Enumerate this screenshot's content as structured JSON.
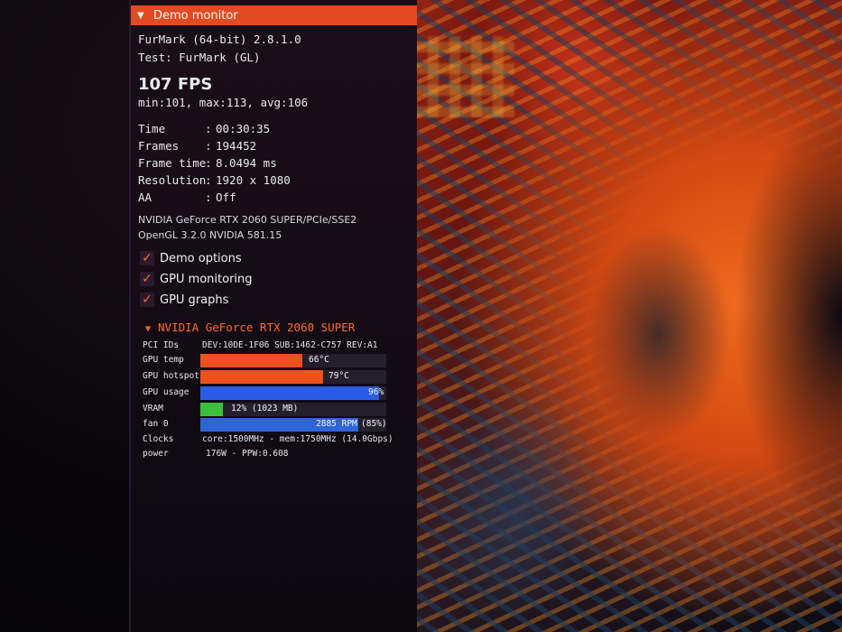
{
  "window": {
    "title": "Demo monitor"
  },
  "app": {
    "version_line": "FurMark (64-bit) 2.8.1.0",
    "test_line": "Test: FurMark (GL)"
  },
  "fps": {
    "value": "107 FPS",
    "stats": "min:101, max:113, avg:106"
  },
  "info": [
    {
      "key": "Time",
      "value": "00:30:35"
    },
    {
      "key": "Frames",
      "value": "194452"
    },
    {
      "key": "Frame time",
      "value": "8.0494 ms"
    },
    {
      "key": "Resolution",
      "value": "1920 x 1080"
    },
    {
      "key": "AA",
      "value": "Off"
    }
  ],
  "renderer": {
    "gpu_line": "NVIDIA GeForce RTX 2060 SUPER/PCIe/SSE2",
    "gl_line": "OpenGL 3.2.0 NVIDIA 581.15"
  },
  "options": [
    {
      "label": "Demo options",
      "checked": true
    },
    {
      "label": "GPU monitoring",
      "checked": true
    },
    {
      "label": "GPU graphs",
      "checked": true
    }
  ],
  "gpu": {
    "name": "NVIDIA GeForce RTX 2060 SUPER",
    "pci_label": "PCI IDs",
    "pci_value": "DEV:10DE-1F06 SUB:1462-C757 REV:A1",
    "temp": {
      "label": "GPU temp",
      "text": "66°C",
      "fraction": 0.55,
      "color": "#f0501c"
    },
    "hotspot": {
      "label": "GPU hotspot",
      "text": "79°C",
      "fraction": 0.66,
      "color": "#f0501c"
    },
    "usage": {
      "label": "GPU usage",
      "text": "96%",
      "fraction": 0.96,
      "color": "#2a5ce8"
    },
    "vram": {
      "label": "VRAM",
      "text": "12% (1023 MB)",
      "fraction": 0.12,
      "color": "#3cbf3c"
    },
    "fan": {
      "label": "fan 0",
      "text": "2885 RPM",
      "extra": "(85%)",
      "fraction": 0.85,
      "color": "#2f63d8"
    },
    "clocks_label": "Clocks",
    "clocks_value": "core:1500MHz - mem:1750MHz (14.0Gbps)",
    "power_label": "power",
    "power_value": "176W - PPW:0.608"
  }
}
